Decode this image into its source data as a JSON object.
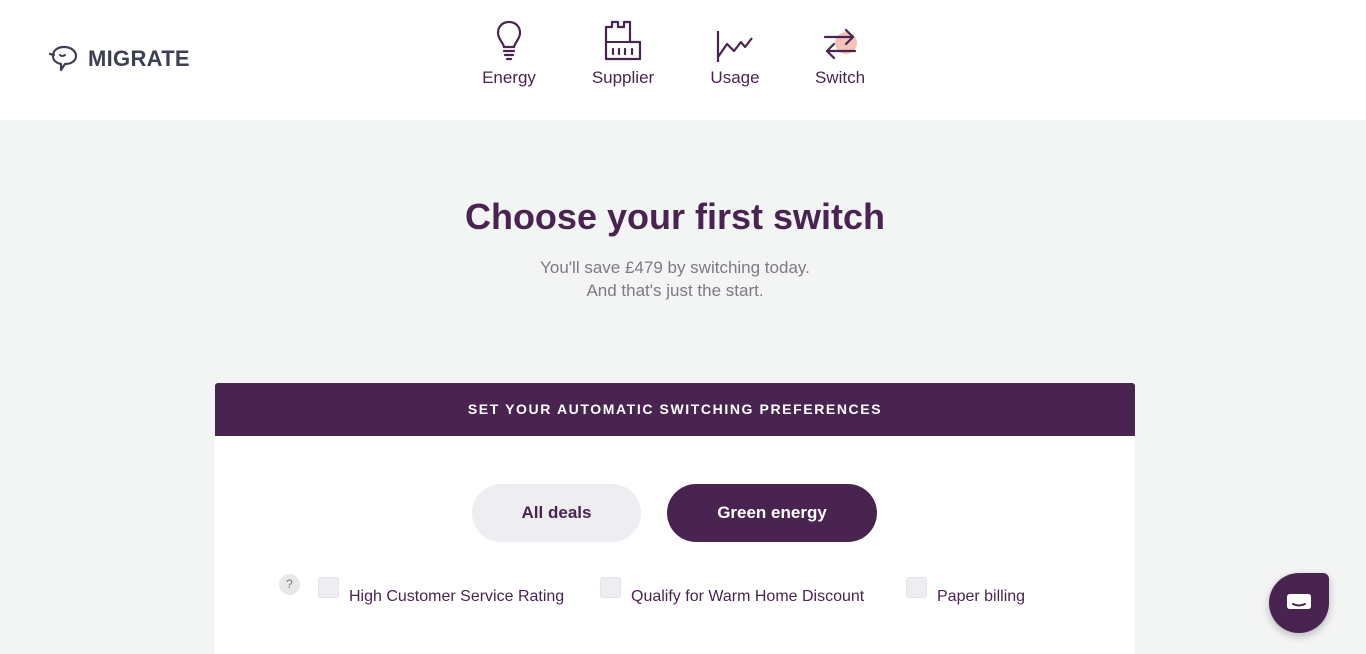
{
  "brand": {
    "name": "MIGRATE"
  },
  "nav": {
    "items": [
      {
        "label": "Energy",
        "icon": "lightbulb-icon"
      },
      {
        "label": "Supplier",
        "icon": "factory-icon"
      },
      {
        "label": "Usage",
        "icon": "line-chart-icon"
      },
      {
        "label": "Switch",
        "icon": "swap-arrows-icon"
      }
    ]
  },
  "hero": {
    "title": "Choose your first switch",
    "line1": "You'll save £479 by switching today.",
    "line2": "And that's just the start."
  },
  "preferences": {
    "header": "SET YOUR AUTOMATIC SWITCHING PREFERENCES",
    "toggle_all": "All deals",
    "toggle_green": "Green energy",
    "help": "?",
    "options": [
      {
        "label": "High Customer Service Rating",
        "checked": false
      },
      {
        "label": "Qualify for Warm Home Discount",
        "checked": false
      },
      {
        "label": "Paper billing",
        "checked": false
      }
    ]
  },
  "colors": {
    "primary": "#4a2451",
    "background": "#f3f4f4",
    "muted_text": "#7b7a85",
    "accent": "#f4c3b8"
  }
}
